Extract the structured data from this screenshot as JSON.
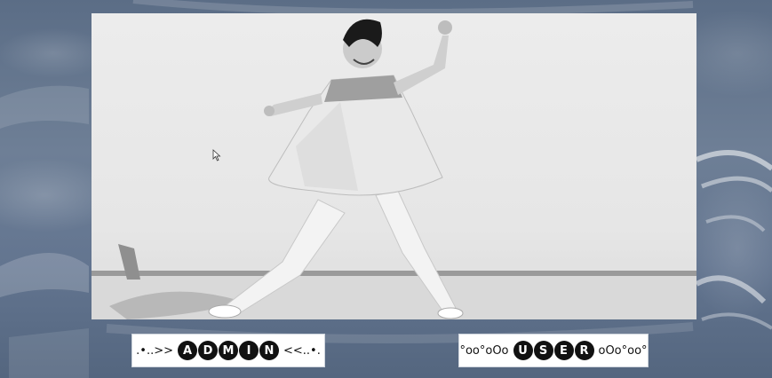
{
  "buttons": {
    "admin": {
      "prefix": ".•..>>",
      "letters": [
        "A",
        "D",
        "M",
        "I",
        "N"
      ],
      "suffix": "<<..•."
    },
    "user": {
      "prefix": "°oo°oOo",
      "letters": [
        "U",
        "S",
        "E",
        "R"
      ],
      "suffix": "oOo°oo°"
    }
  },
  "colors": {
    "background": "#637590",
    "button_bg": "#ffffff",
    "letter_bubble": "#111111"
  },
  "icons": {
    "cursor": "mouse-pointer-icon"
  }
}
